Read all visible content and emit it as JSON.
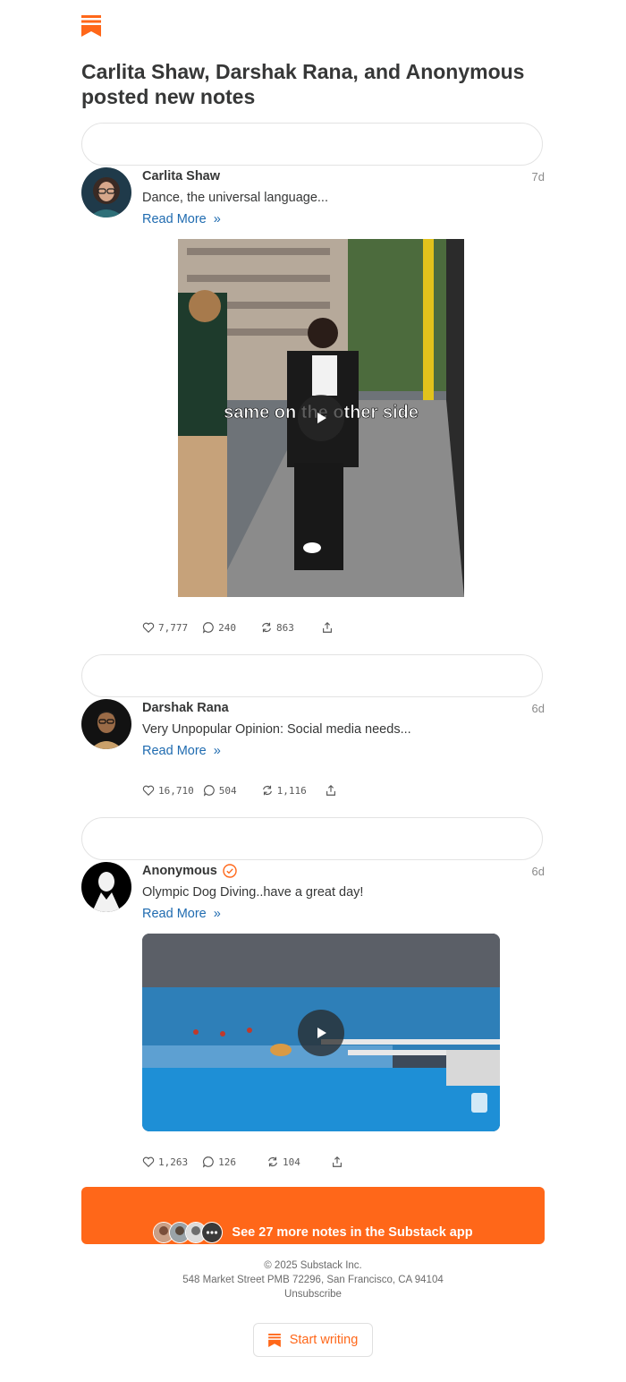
{
  "header": {
    "logo_icon": "substack-logo-icon",
    "headline": "Carlita Shaw, Darshak Rana, and Anonymous posted new notes"
  },
  "notes": [
    {
      "author": "Carlita Shaw",
      "time": "7d",
      "text": "Dance, the universal language...",
      "read_more": "Read More",
      "video_caption": "same on the other side",
      "likes": "7,777",
      "comments": "240",
      "restacks": "863"
    },
    {
      "author": "Darshak Rana",
      "time": "6d",
      "text": "Very Unpopular Opinion: Social media needs...",
      "read_more": "Read More",
      "likes": "16,710",
      "comments": "504",
      "restacks": "1,116"
    },
    {
      "author": "Anonymous",
      "time": "6d",
      "text": "Olympic Dog Diving..have a great day!",
      "read_more": "Read More",
      "likes": "1,263",
      "comments": "126",
      "restacks": "104"
    }
  ],
  "cta": {
    "label": "See 27 more notes in the Substack app",
    "more_icon": "ellipsis-icon"
  },
  "footer": {
    "copyright": "© 2025 Substack Inc.",
    "address": "548 Market Street PMB 72296, San Francisco, CA 94104",
    "unsubscribe": "Unsubscribe"
  },
  "start_writing": {
    "label": "Start writing"
  },
  "colors": {
    "brand": "#ff6719",
    "link": "#1f6bb0",
    "text": "#363737"
  }
}
